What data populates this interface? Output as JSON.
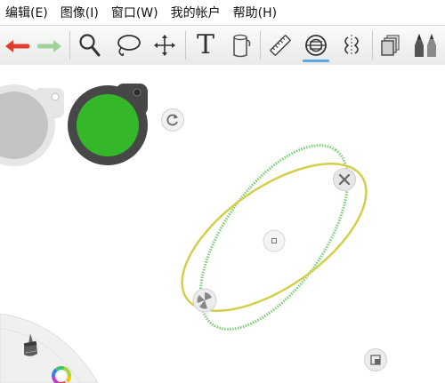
{
  "menubar": {
    "items": [
      {
        "label": "编辑(E)"
      },
      {
        "label": "图像(I)"
      },
      {
        "label": "窗口(W)"
      },
      {
        "label": "我的帐户"
      },
      {
        "label": "帮助(H)"
      }
    ]
  },
  "toolbar": {
    "tools": [
      {
        "name": "undo-icon"
      },
      {
        "name": "redo-icon"
      },
      {
        "name": "zoom-icon"
      },
      {
        "name": "lasso-icon"
      },
      {
        "name": "move-icon"
      },
      {
        "name": "text-icon"
      },
      {
        "name": "paint-bucket-icon"
      },
      {
        "name": "ruler-icon"
      },
      {
        "name": "ellipse-guide-icon",
        "active": true
      },
      {
        "name": "symmetry-icon"
      },
      {
        "name": "layers-icon"
      },
      {
        "name": "brush-set-icon"
      }
    ],
    "text_tool_glyph": "T"
  },
  "colors": {
    "undo": "#e23a2e",
    "redo": "#9fd39a",
    "active_underline": "#5aa7e6",
    "current_color": "#34b82a",
    "previous_color": "#c4c4c4",
    "ellipse_yellow": "#d4cf4a",
    "ellipse_green": "#7ccd76"
  }
}
